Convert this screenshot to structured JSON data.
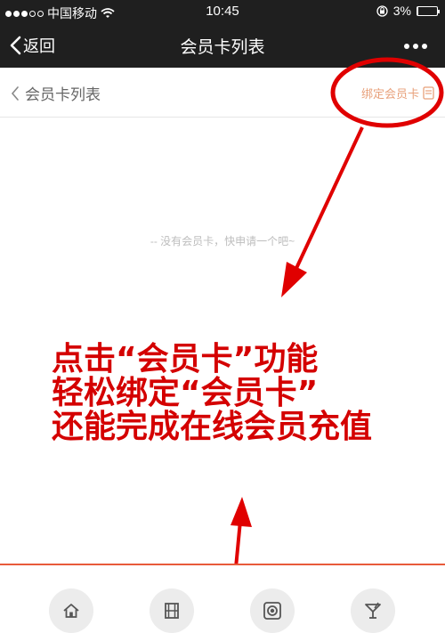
{
  "status_bar": {
    "carrier": "中国移动",
    "time": "10:45",
    "battery": "3%",
    "battery_level": 0.03,
    "icons": [
      "signal-dots",
      "wifi-icon",
      "orientation-lock-icon",
      "battery-icon"
    ]
  },
  "nav": {
    "back_label": "返回",
    "title": "会员卡列表",
    "more_icon": "more-icon"
  },
  "page": {
    "back_label": "会员卡列表",
    "bind_label": "绑定会员卡",
    "empty_message": "-- 没有会员卡，快申请一个吧~"
  },
  "annotation": {
    "lines": [
      "点击“会员卡”功能",
      "轻松绑定“会员卡”",
      "还能完成在线会员充值"
    ],
    "color": "#d40000"
  },
  "tabbar": {
    "icons": [
      "home-icon",
      "film-icon",
      "camera-icon",
      "cocktail-icon"
    ]
  },
  "colors": {
    "bar_bg": "#1f1f1f",
    "bind_link": "#e8a17b",
    "accent_line": "#e85a3a",
    "annotation_red": "#d40000"
  }
}
